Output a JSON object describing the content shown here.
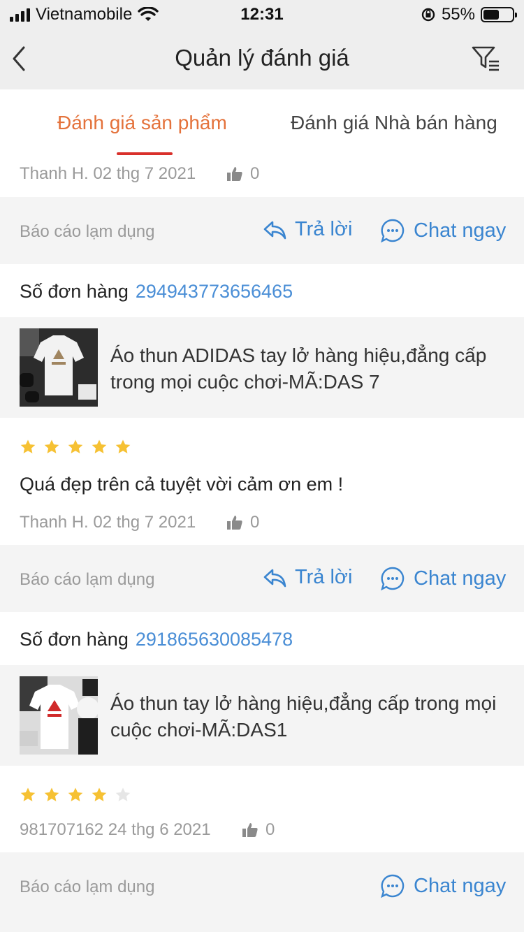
{
  "status_bar": {
    "carrier": "Vietnamobile",
    "time": "12:31",
    "battery_text": "55%",
    "battery_level": 0.55
  },
  "nav": {
    "title": "Quản lý đánh giá",
    "back_icon": "chevron-left-icon",
    "filter_icon": "filter-list-icon"
  },
  "tabs": {
    "product": "Đánh giá sản phẩm",
    "seller": "Đánh giá Nhà bán hàng",
    "active_color": "#e4723b"
  },
  "labels": {
    "report": "Báo cáo lạm dụng",
    "reply": "Trả lời",
    "chat": "Chat ngay",
    "order_label": "Số đơn hàng"
  },
  "reviews": [
    {
      "meta": "Thanh H. 02 thg 7 2021",
      "likes": "0"
    },
    {
      "order_number": "294943773656465",
      "product_title": "Áo thun ADIDAS tay lở hàng hiệu,đẳng cấp trong mọi cuộc chơi-MÃ:DAS 7",
      "rating": 5,
      "comment": "Quá đẹp trên cả tuyệt vời cảm ơn em !",
      "meta": "Thanh H. 02 thg 7 2021",
      "likes": "0"
    },
    {
      "order_number": "291865630085478",
      "product_title": "Áo thun tay lở hàng hiệu,đẳng cấp trong mọi cuộc chơi-MÃ:DAS1",
      "rating": 4,
      "meta": "981707162 24 thg 6 2021",
      "likes": "0"
    }
  ],
  "colors": {
    "link_blue": "#3a85d0",
    "star_gold": "#f6c133",
    "star_empty": "#e6e6e6",
    "tab_underline": "#d9302b"
  }
}
